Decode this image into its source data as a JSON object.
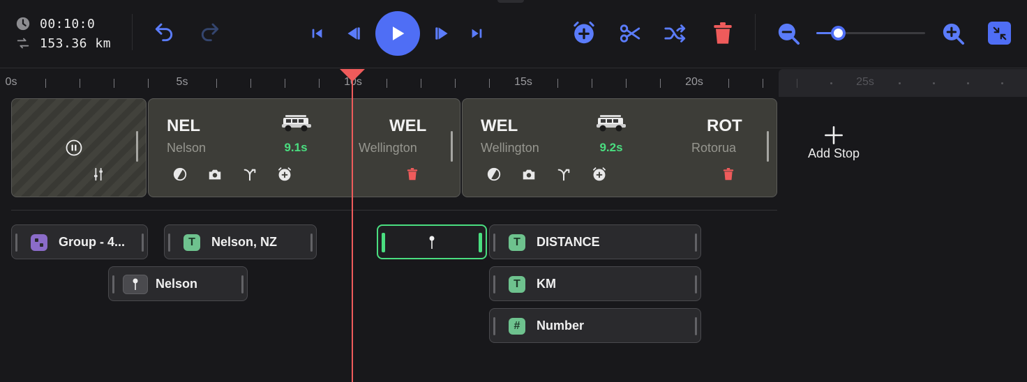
{
  "toolbar": {
    "elapsed_time": "00:10:0",
    "distance": "153.36 km",
    "zoom_level": 0.2,
    "colors": {
      "accent": "#4f6ef5",
      "danger": "#ef5b5b",
      "success": "#4ade80"
    },
    "icons": [
      "clock-icon",
      "route-icon",
      "undo-icon",
      "redo-icon",
      "skip-start-icon",
      "step-back-icon",
      "play-icon",
      "step-forward-icon",
      "skip-end-icon",
      "alarm-add-icon",
      "scissors-icon",
      "shuffle-icon",
      "trash-icon",
      "zoom-out-icon",
      "zoom-in-icon",
      "collapse-icon"
    ]
  },
  "ruler": {
    "labels": [
      "0s",
      "5s",
      "10s",
      "15s",
      "20s",
      "25s"
    ]
  },
  "segments": [
    {
      "from_code": "NEL",
      "from_city": "Nelson",
      "to_code": "WEL",
      "to_city": "Wellington",
      "duration": "9.1s"
    },
    {
      "from_code": "WEL",
      "from_city": "Wellington",
      "to_code": "ROT",
      "to_city": "Rotorua",
      "duration": "9.2s"
    }
  ],
  "add_stop_label": "Add Stop",
  "layers": {
    "group": "Group - 4...",
    "title_nelson_nz": "Nelson, NZ",
    "pin_nelson": "Nelson",
    "distance_text": "DISTANCE",
    "km_text": "KM",
    "number": "Number",
    "icon_text": "T",
    "icon_number": "#"
  }
}
